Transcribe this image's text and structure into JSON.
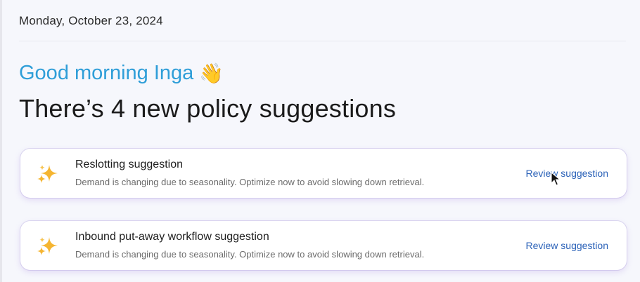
{
  "header": {
    "date": "Monday, October 23, 2024"
  },
  "greeting": {
    "text": "Good morning Inga",
    "emoji": "👋",
    "color": "#2f9ed8"
  },
  "headline": "There’s 4 new policy suggestions",
  "suggestions": [
    {
      "icon": "sparkle-icon",
      "title": "Reslotting suggestion",
      "description": "Demand is changing due to seasonality. Optimize now to avoid slowing down retrieval.",
      "action": "Review suggestion"
    },
    {
      "icon": "sparkle-icon",
      "title": "Inbound put-away workflow suggestion",
      "description": "Demand is changing due to seasonality. Optimize now to avoid slowing down retrieval.",
      "action": "Review suggestion"
    }
  ],
  "colors": {
    "accent": "#2f9ed8",
    "link": "#2b62b8",
    "sparkle": "#f5b531"
  }
}
